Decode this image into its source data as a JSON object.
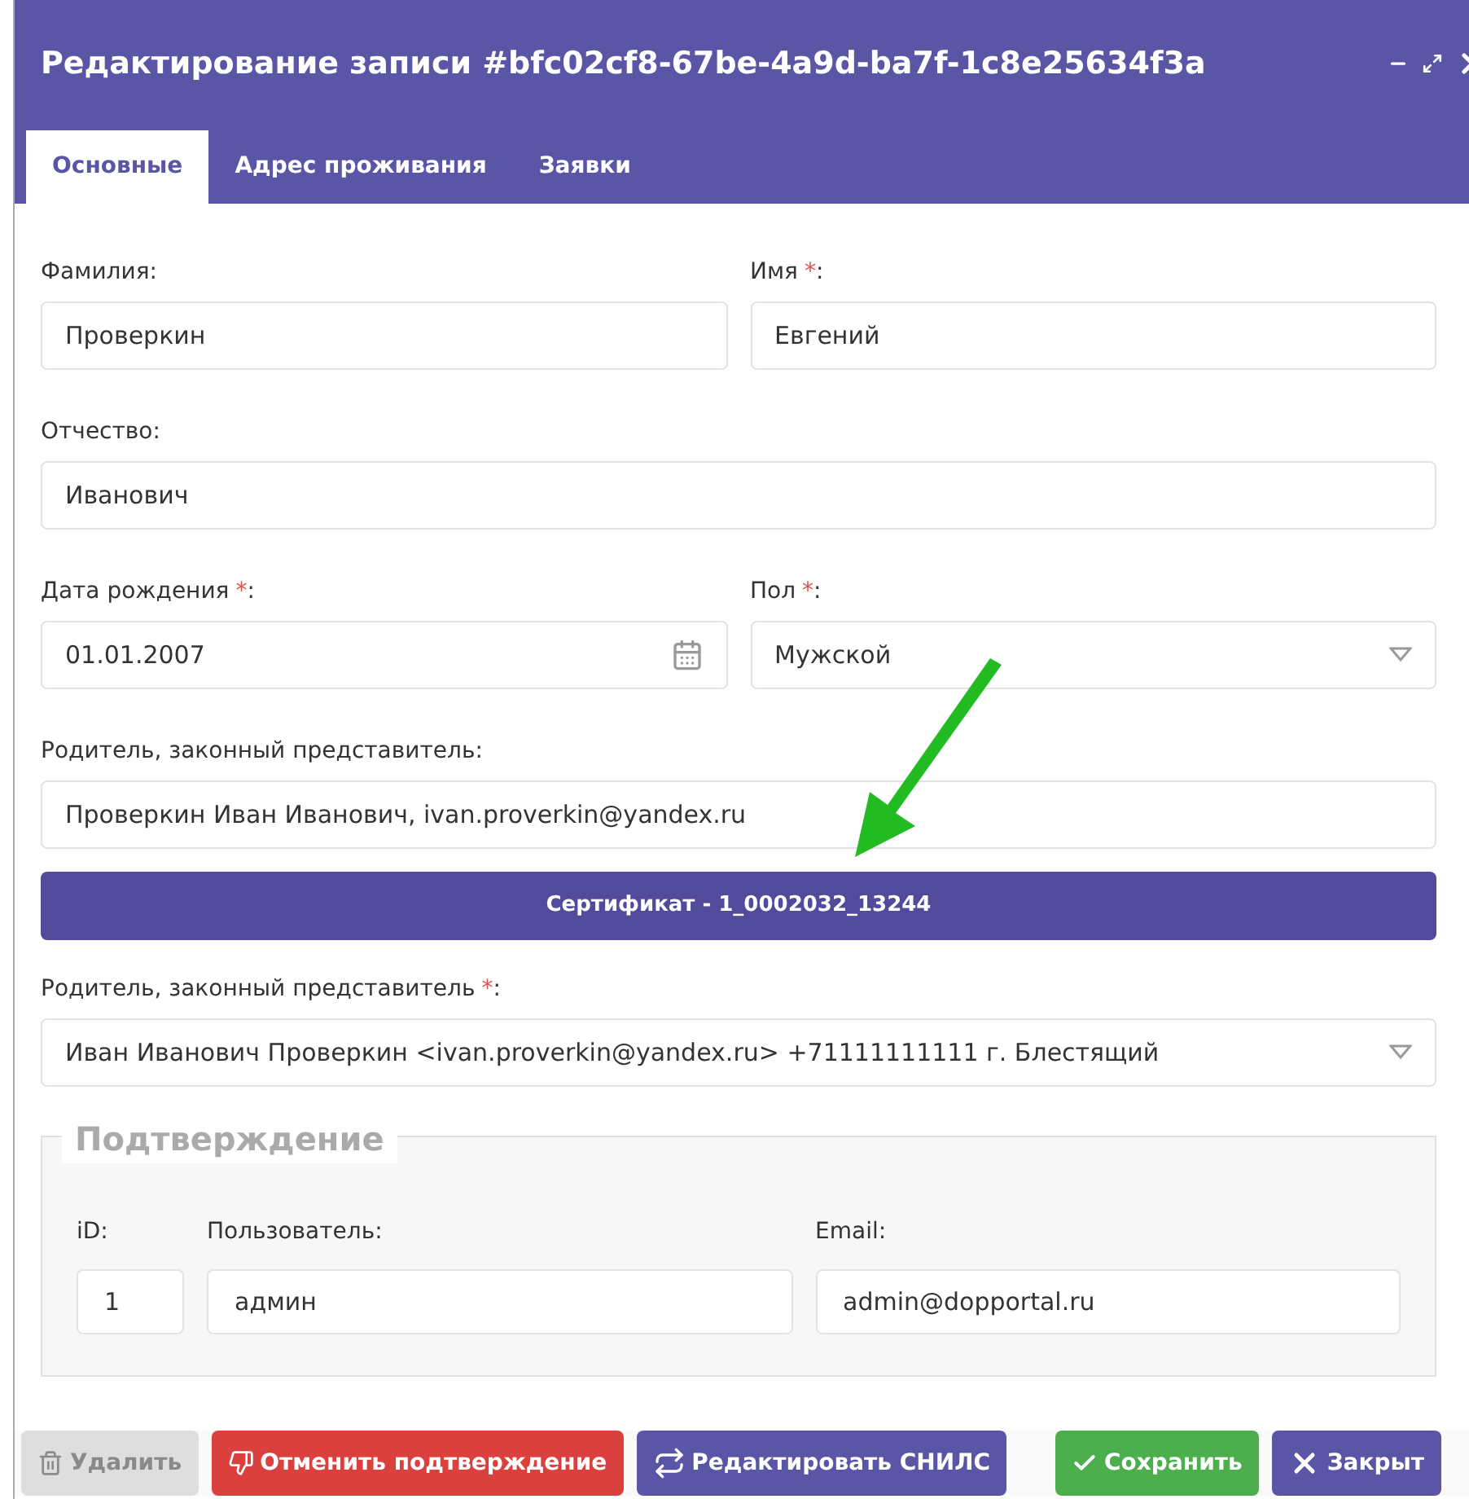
{
  "window": {
    "title": "Редактирование записи #bfc02cf8-67be-4a9d-ba7f-1c8e25634f3a"
  },
  "tabs": [
    {
      "label": "Основные",
      "selected": true
    },
    {
      "label": "Адрес проживания",
      "selected": false
    },
    {
      "label": "Заявки",
      "selected": false
    }
  ],
  "rows": [
    [
      {
        "label": "Фамилия:",
        "kind": "text",
        "value": "Проверкин"
      },
      {
        "label": "Имя",
        "required_mark": "*",
        "label_suffix": ":",
        "kind": "text",
        "value": "Евгений"
      }
    ],
    [
      {
        "label": "Отчество:",
        "kind": "text",
        "value": "Иванович"
      }
    ],
    [
      {
        "label": "Дата рождения",
        "required_mark": "*",
        "label_suffix": ":",
        "kind": "date",
        "value": "01.01.2007"
      },
      {
        "label": "Пол",
        "required_mark": "*",
        "label_suffix": ":",
        "kind": "select",
        "value": "Мужской"
      }
    ],
    [
      {
        "label": "Родитель, законный представитель:",
        "kind": "text",
        "value": "Проверкин Иван Иванович, ivan.proverkin@yandex.ru"
      }
    ]
  ],
  "certificate_bar": "Сертификат - 1_0002032_13244",
  "parent_select": {
    "label": "Родитель, законный представитель",
    "required_mark": "*",
    "label_suffix": ":",
    "kind": "select",
    "value": "Иван Иванович Проверкин <ivan.proverkin@yandex.ru> +71111111111 г. Блестящий"
  },
  "confirmation": {
    "legend": "Подтверждение",
    "fields": [
      {
        "label": "iD:",
        "value": "1"
      },
      {
        "label": "Пользователь:",
        "value": "админ"
      },
      {
        "label": "Email:",
        "value": "admin@dopportal.ru"
      }
    ]
  },
  "buttons": [
    {
      "label": "Удалить",
      "kind": "delete",
      "disabled": true
    },
    {
      "label": "Отменить подтверждение",
      "kind": "unconfirm",
      "disabled": false
    },
    {
      "label": "Редактировать СНИЛС",
      "kind": "edit",
      "disabled": false
    },
    {
      "label": "Сохранить",
      "kind": "save",
      "disabled": false
    },
    {
      "label": "Закрыт",
      "kind": "close",
      "disabled": false
    }
  ]
}
